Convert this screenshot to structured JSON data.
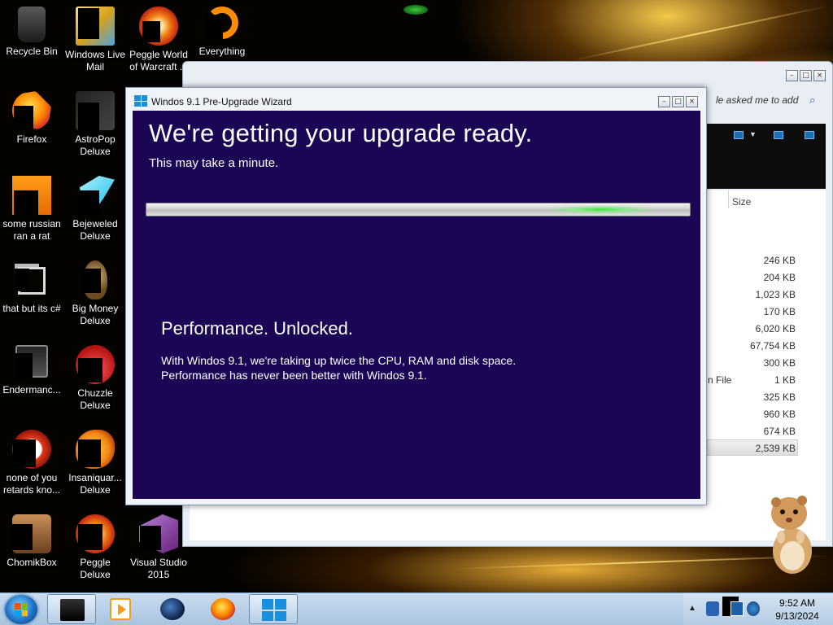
{
  "desktop": {
    "icons": [
      {
        "label": "Recycle Bin",
        "icon": "recycle-bin-icon"
      },
      {
        "label": "Windows Live Mail",
        "icon": "windows-live-mail-icon"
      },
      {
        "label": "Peggle World of Warcraft ...",
        "icon": "peggle-wow-icon"
      },
      {
        "label": "Everything",
        "icon": "everything-search-icon"
      },
      {
        "label": "Firefox",
        "icon": "firefox-icon"
      },
      {
        "label": "AstroPop Deluxe",
        "icon": "astropop-icon"
      },
      {
        "label": "some russian ran a rat",
        "icon": "ragdoll-icon"
      },
      {
        "label": "Bejeweled Deluxe",
        "icon": "bejeweled-icon"
      },
      {
        "label": "that but its c#",
        "icon": "copy-windows-icon"
      },
      {
        "label": "Big Money Deluxe",
        "icon": "big-money-icon"
      },
      {
        "label": "Endermanc...",
        "icon": "enderman-icon"
      },
      {
        "label": "Chuzzle Deluxe",
        "icon": "chuzzle-icon"
      },
      {
        "label": "none of you retards kno...",
        "icon": "red-circle-icon"
      },
      {
        "label": "Insaniquar... Deluxe",
        "icon": "insaniquarium-icon"
      },
      {
        "label": "ChomikBox",
        "icon": "chomikbox-icon"
      },
      {
        "label": "Peggle Deluxe",
        "icon": "peggle-icon"
      },
      {
        "label": "Visual Studio 2015",
        "icon": "visual-studio-icon"
      }
    ]
  },
  "explorer": {
    "search_hint": "le asked me to add",
    "size_header": "Size",
    "type_partial": "n File",
    "sizes": [
      "246 KB",
      "204 KB",
      "1,023 KB",
      "170 KB",
      "6,020 KB",
      "67,754 KB",
      "300 KB",
      "1 KB",
      "325 KB",
      "960 KB",
      "674 KB",
      "2,539 KB"
    ]
  },
  "wizard": {
    "title": "Windos 9.1 Pre-Upgrade Wizard",
    "headline": "We're getting your upgrade ready.",
    "subline": "This may take a minute.",
    "promo_title": "Performance. Unlocked.",
    "promo_line1": "With Windos 9.1, we're taking up twice the CPU, RAM and disk space.",
    "promo_line2": "Performance has never been better with Windos 9.1.",
    "progress_state": "indeterminate"
  },
  "taskbar": {
    "items": [
      {
        "name": "monitor-app-icon"
      },
      {
        "name": "media-player-icon"
      },
      {
        "name": "globe-app-icon"
      },
      {
        "name": "firefox-icon"
      },
      {
        "name": "windows-logo-icon"
      }
    ],
    "clock_time": "9:52 AM",
    "clock_date": "9/13/2024"
  },
  "colors": {
    "wizard_bg": "#1a0655",
    "progress_glow": "#3ce23c",
    "taskbar": "#b9d0e8"
  }
}
